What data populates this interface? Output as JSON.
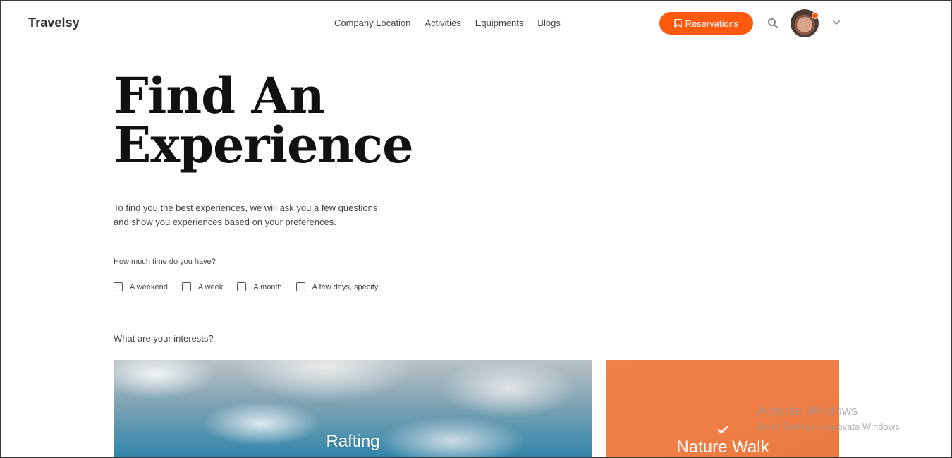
{
  "header": {
    "brand": "Travelsy",
    "nav": [
      "Company Location",
      "Activities",
      "Equipments",
      "Blogs"
    ],
    "reservations_label": "Reservations",
    "accent_color": "#ff5a10"
  },
  "icons": {
    "reservations": "bookmark-icon",
    "search": "search-icon",
    "profile": "avatar",
    "menu": "chevron-down-icon",
    "selected": "check-icon"
  },
  "main": {
    "title_line1": "Find An",
    "title_line2": "Experience",
    "intro_line1": "To find you the best experiences, we will ask you a few questions",
    "intro_line2": "and show you experiences based on your preferences.",
    "time_question": "How much time do you have?",
    "time_options": [
      "A weekend",
      "A week",
      "A month",
      "A few days, specify."
    ],
    "interests_question": "What are your interests?",
    "interests": [
      {
        "label": "Rafting",
        "selected": false
      },
      {
        "label": "Nature Walk",
        "selected": true
      }
    ]
  },
  "os_overlay": {
    "line1": "Activate Windows",
    "line2": "Go to Settings to activate Windows."
  }
}
